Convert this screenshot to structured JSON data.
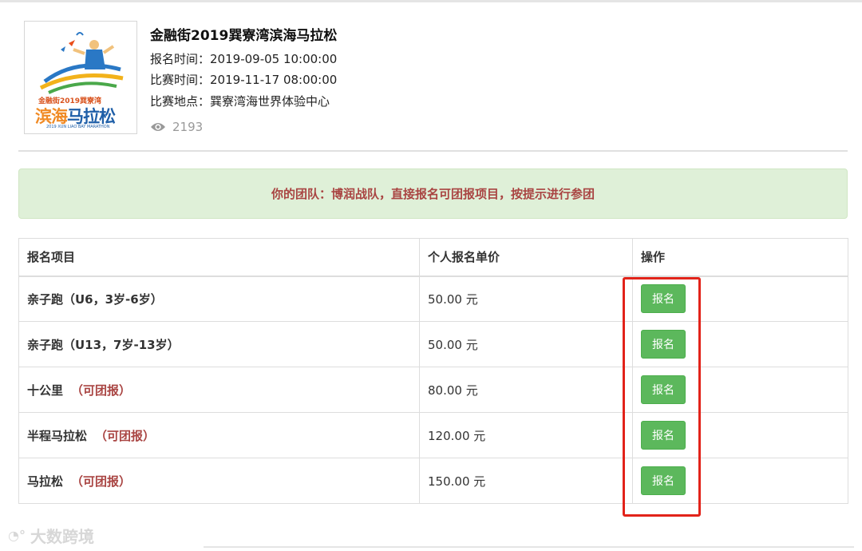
{
  "event": {
    "title": "金融街2019巽寮湾滨海马拉松",
    "registration_time_label": "报名时间：",
    "registration_time": "2019-09-05 10:00:00",
    "race_time_label": "比赛时间：",
    "race_time": "2019-11-17 08:00:00",
    "venue_label": "比赛地点：",
    "venue": "巽寮湾海世界体验中心",
    "views": "2193",
    "poster": {
      "line1": "金融街2019巽寮湾",
      "line2a": "滨海",
      "line2b": "马拉松",
      "line3": "2019 XUN LIAO BAY MARATHON"
    }
  },
  "notice": "你的团队：博润战队，直接报名可团报项目，按提示进行参团",
  "table": {
    "headers": [
      "报名项目",
      "个人报名单价",
      "操作"
    ],
    "rows": [
      {
        "name": "亲子跑（U6，3岁-6岁）",
        "tag": "",
        "price": "50.00 元",
        "action": "报名"
      },
      {
        "name": "亲子跑（U13，7岁-13岁）",
        "tag": "",
        "price": "50.00 元",
        "action": "报名"
      },
      {
        "name": "十公里",
        "tag": "（可团报）",
        "price": "80.00 元",
        "action": "报名"
      },
      {
        "name": "半程马拉松",
        "tag": "（可团报）",
        "price": "120.00 元",
        "action": "报名"
      },
      {
        "name": "马拉松",
        "tag": "（可团报）",
        "price": "150.00 元",
        "action": "报名"
      }
    ]
  },
  "watermark": "大数跨境",
  "colors": {
    "register_button": "#5cb85c",
    "notice_bg": "#dff0d8",
    "notice_text": "#a94442",
    "tag_text": "#a94442",
    "highlight_box": "#e2231a"
  }
}
